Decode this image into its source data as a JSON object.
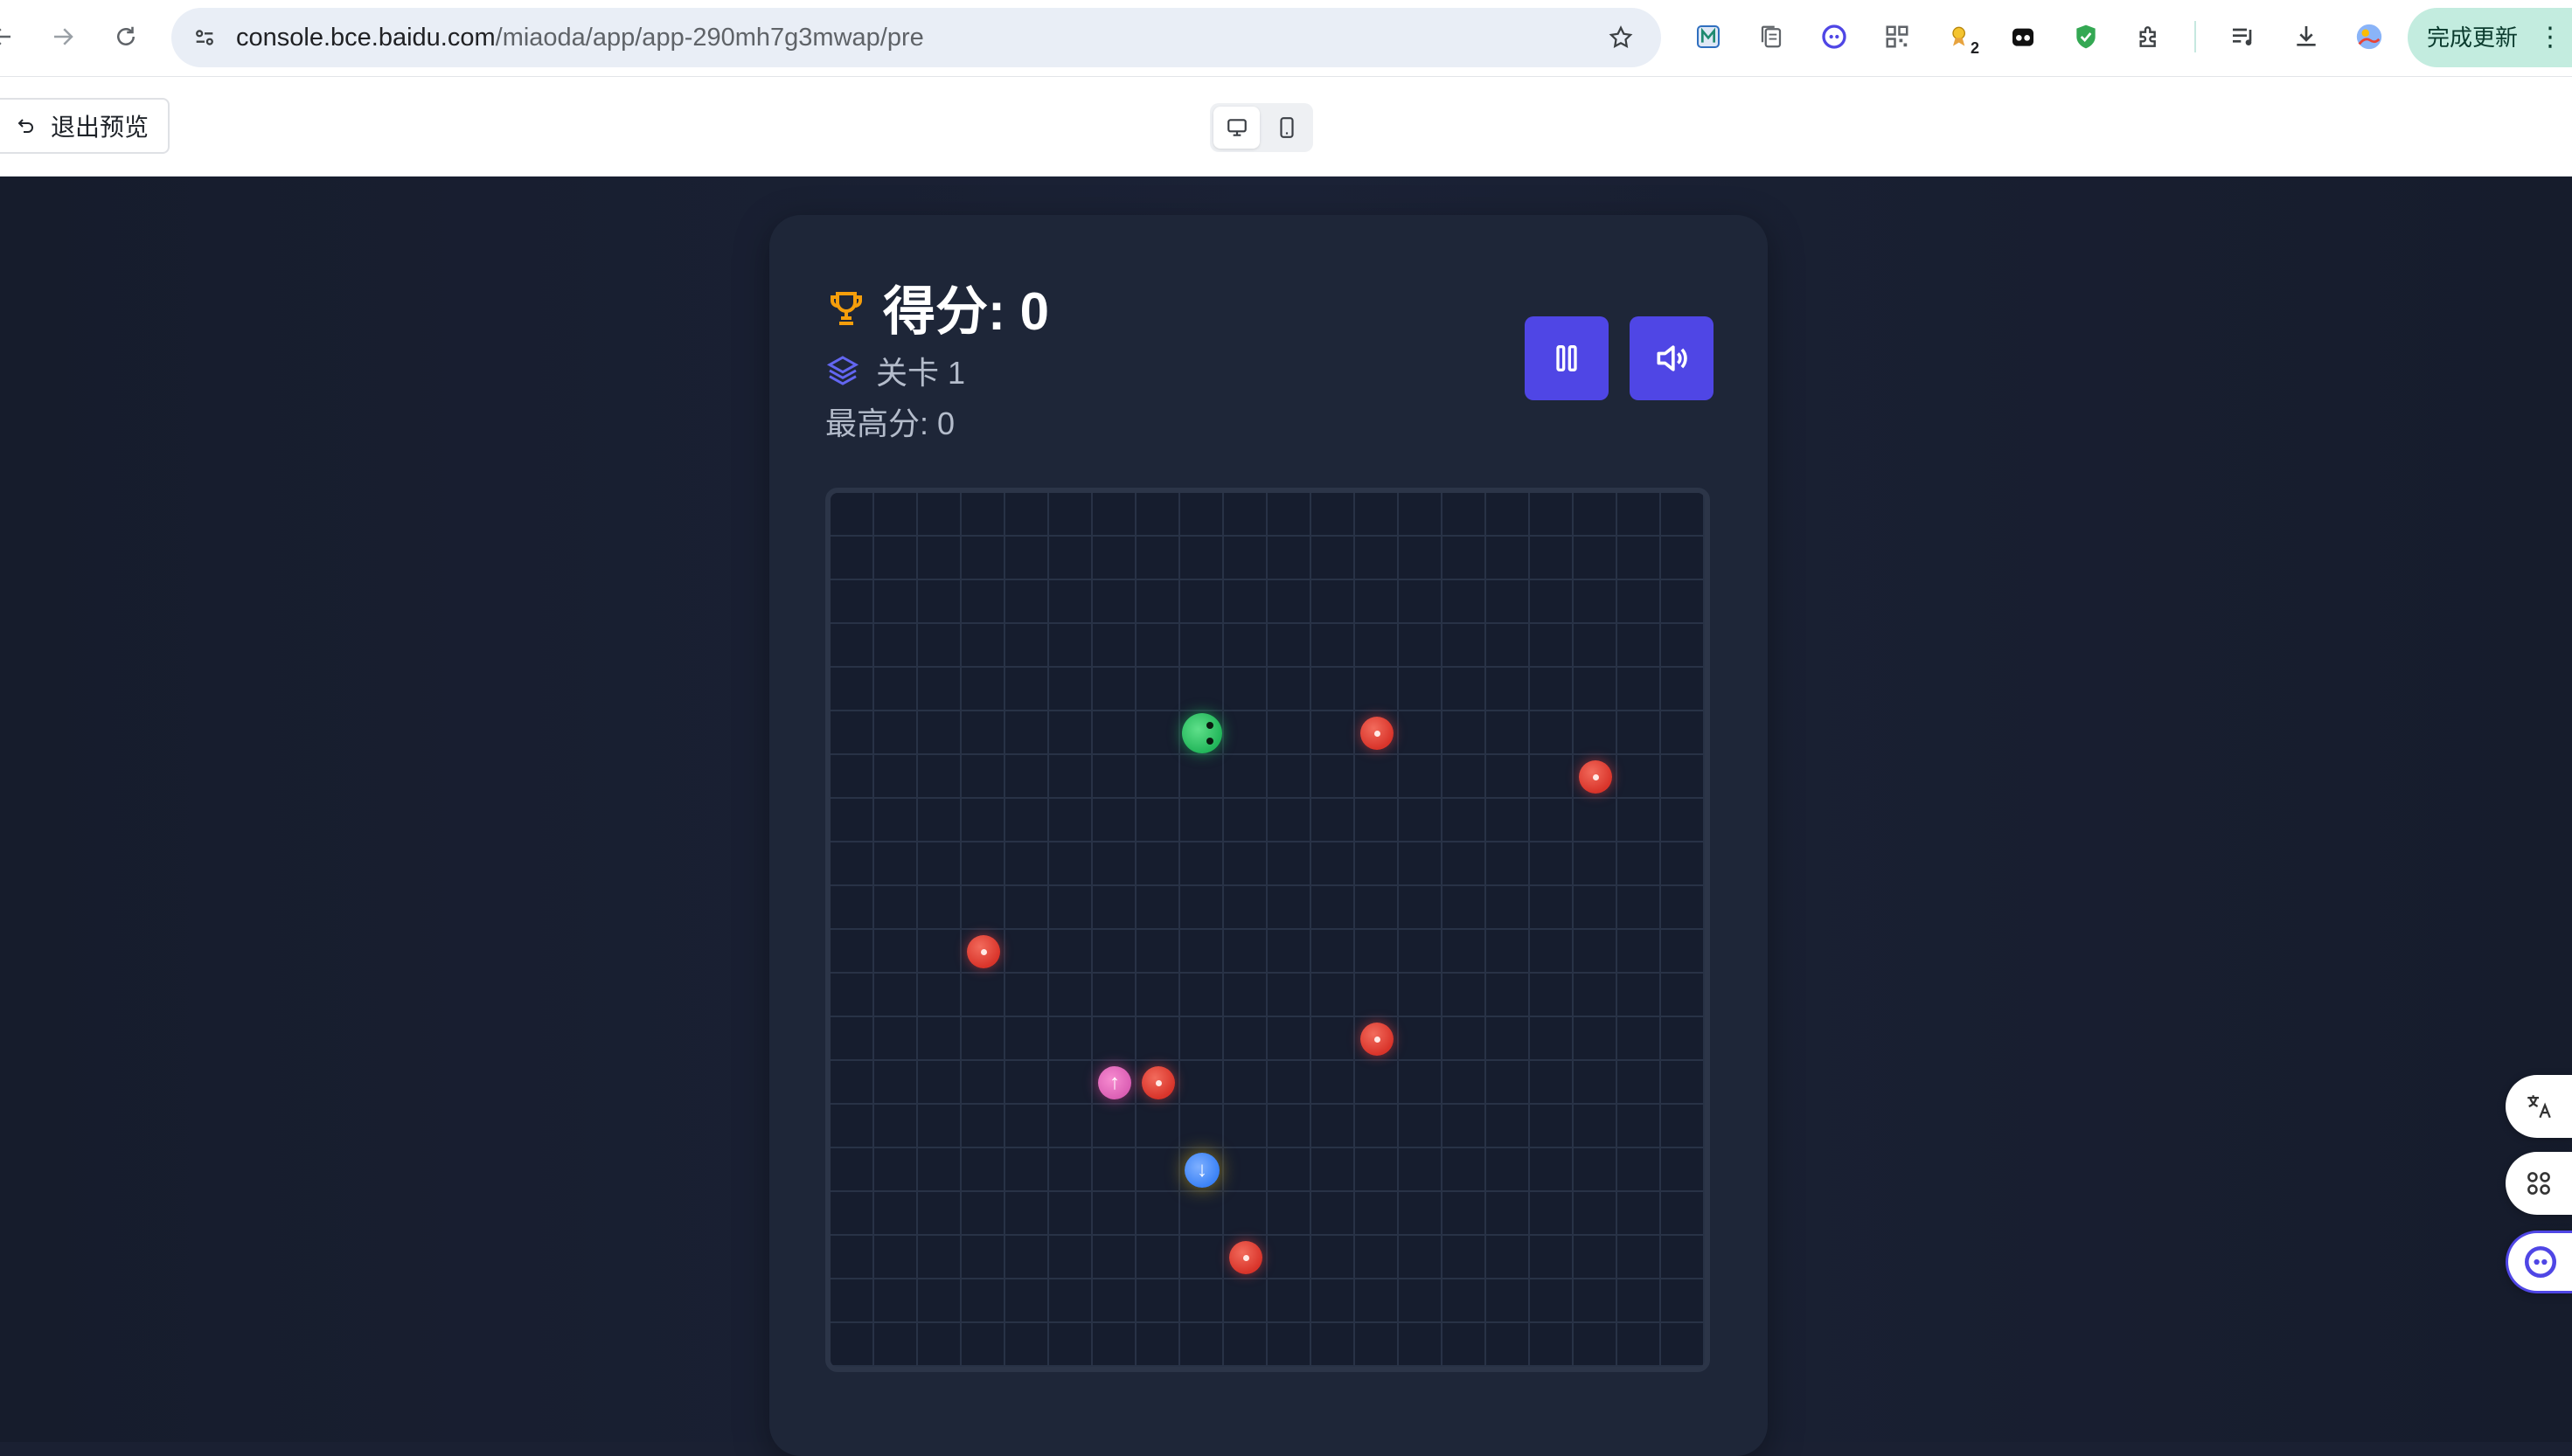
{
  "browser": {
    "url_host": "console.bce.baidu.com",
    "url_path": "/miaoda/app/app-290mh7g3mwap/pre",
    "update_label": "完成更新",
    "extension_badge": "2"
  },
  "preview_bar": {
    "exit_label": "退出预览",
    "view_modes": [
      "desktop",
      "mobile"
    ],
    "active_view": "desktop"
  },
  "game": {
    "score_text": "得分: 0",
    "score": 0,
    "level_text": "关卡 1",
    "best_text": "最高分: 0",
    "controls": {
      "pause_icon": "pause-icon",
      "sound_icon": "volume-icon"
    },
    "grid_cells": 20,
    "snake_head": {
      "col": 8,
      "row": 5,
      "color": "#22c55e"
    },
    "obstacles": [
      {
        "col": 12,
        "row": 5
      },
      {
        "col": 17,
        "row": 6
      },
      {
        "col": 3,
        "row": 10
      },
      {
        "col": 12,
        "row": 12
      },
      {
        "col": 7,
        "row": 13
      },
      {
        "col": 9,
        "row": 17
      }
    ],
    "powerups": [
      {
        "col": 6,
        "row": 13,
        "kind": "pink",
        "glyph": "↑"
      },
      {
        "col": 8,
        "row": 15,
        "kind": "blue",
        "glyph": "↓"
      }
    ],
    "colors": {
      "accent": "#4f46e5",
      "obstacle": "#ef4444",
      "trophy": "#f59e0b",
      "layers": "#6366f1"
    }
  },
  "side_tools": [
    "translate-icon",
    "apps-icon",
    "assistant-icon"
  ]
}
